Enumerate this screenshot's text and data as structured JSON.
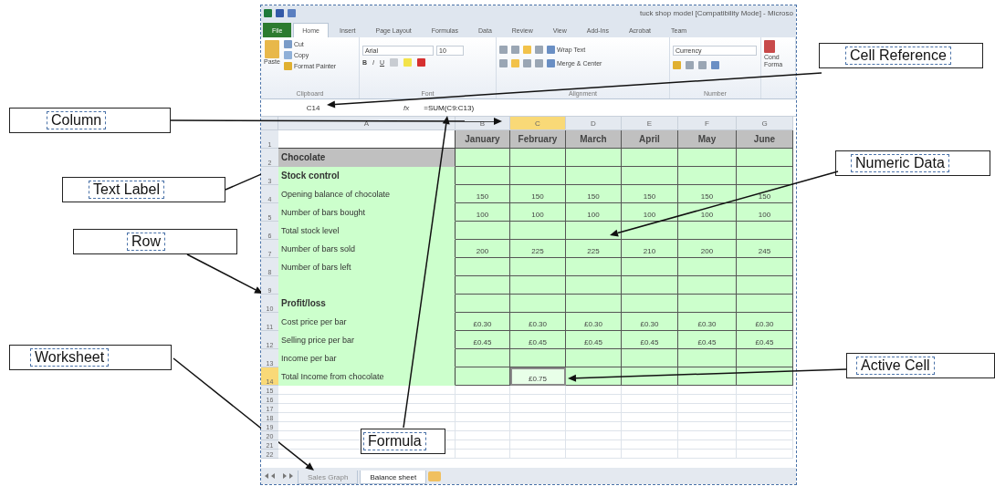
{
  "window": {
    "title": "tuck shop model [Compatibility Mode] - Microso"
  },
  "ribbon_tabs": [
    {
      "label": "File",
      "kind": "file",
      "selected": false
    },
    {
      "label": "Home",
      "kind": "tab",
      "selected": true
    },
    {
      "label": "Insert",
      "kind": "tab",
      "selected": false
    },
    {
      "label": "Page Layout",
      "kind": "tab",
      "selected": false
    },
    {
      "label": "Formulas",
      "kind": "tab",
      "selected": false
    },
    {
      "label": "Data",
      "kind": "tab",
      "selected": false
    },
    {
      "label": "Review",
      "kind": "tab",
      "selected": false
    },
    {
      "label": "View",
      "kind": "tab",
      "selected": false
    },
    {
      "label": "Add-Ins",
      "kind": "tab",
      "selected": false
    },
    {
      "label": "Acrobat",
      "kind": "tab",
      "selected": false
    },
    {
      "label": "Team",
      "kind": "tab",
      "selected": false
    }
  ],
  "ribbon": {
    "clipboard": {
      "label": "Clipboard",
      "paste": "Paste",
      "cut": "Cut",
      "copy": "Copy",
      "format_painter": "Format Painter"
    },
    "font": {
      "label": "Font",
      "font_name": "Arial",
      "font_size": "10",
      "bold": "B",
      "italic": "I",
      "underline": "U"
    },
    "alignment": {
      "label": "Alignment",
      "wrap_text": "Wrap Text",
      "merge": "Merge & Center"
    },
    "number": {
      "label": "Number",
      "format": "Currency"
    },
    "styles": {
      "line_1": "Cond",
      "line_2": "Forma"
    }
  },
  "formula_bar": {
    "name_box": "C14",
    "fx": "fx",
    "formula": "=SUM(C9:C13)"
  },
  "columns": [
    {
      "label": "A",
      "selected": false
    },
    {
      "label": "B",
      "selected": false
    },
    {
      "label": "C",
      "selected": true
    },
    {
      "label": "D",
      "selected": false
    },
    {
      "label": "E",
      "selected": false
    },
    {
      "label": "F",
      "selected": false
    },
    {
      "label": "G",
      "selected": false
    }
  ],
  "rows": [
    {
      "number": "1",
      "kind": "header",
      "selected": false,
      "cells": [
        {
          "text": "January",
          "selected": false
        },
        {
          "text": "February",
          "selected": false
        },
        {
          "text": "March",
          "selected": false
        },
        {
          "text": "April",
          "selected": false
        },
        {
          "text": "May",
          "selected": false
        },
        {
          "text": "June",
          "selected": false
        }
      ]
    },
    {
      "number": "2",
      "kind": "title",
      "label": "Chocolate",
      "selected": false,
      "cells": [
        {
          "selected": false
        },
        {
          "selected": false
        },
        {
          "selected": false
        },
        {
          "selected": false
        },
        {
          "selected": false
        },
        {
          "selected": false
        }
      ]
    },
    {
      "number": "3",
      "kind": "heading",
      "label": "Stock control",
      "selected": false,
      "cells": [
        {
          "selected": false
        },
        {
          "selected": false
        },
        {
          "selected": false
        },
        {
          "selected": false
        },
        {
          "selected": false
        },
        {
          "selected": false
        }
      ]
    },
    {
      "number": "4",
      "kind": "item",
      "label": "Opening balance of chocolate",
      "selected": false,
      "cells": [
        {
          "text": "150",
          "selected": false
        },
        {
          "text": "150",
          "selected": false
        },
        {
          "text": "150",
          "selected": false
        },
        {
          "text": "150",
          "selected": false
        },
        {
          "text": "150",
          "selected": false
        },
        {
          "text": "150",
          "selected": false
        }
      ]
    },
    {
      "number": "5",
      "kind": "item",
      "label": "Number of bars bought",
      "selected": false,
      "cells": [
        {
          "text": "100",
          "selected": false
        },
        {
          "text": "100",
          "selected": false
        },
        {
          "text": "100",
          "selected": false
        },
        {
          "text": "100",
          "selected": false
        },
        {
          "text": "100",
          "selected": false
        },
        {
          "text": "100",
          "selected": false
        }
      ]
    },
    {
      "number": "6",
      "kind": "item",
      "label": "Total stock level",
      "selected": false,
      "cells": [
        {
          "selected": false
        },
        {
          "selected": false
        },
        {
          "selected": false
        },
        {
          "selected": false
        },
        {
          "selected": false
        },
        {
          "selected": false
        }
      ]
    },
    {
      "number": "7",
      "kind": "item",
      "label": "Number of bars sold",
      "selected": false,
      "cells": [
        {
          "text": "200",
          "selected": false
        },
        {
          "text": "225",
          "selected": false
        },
        {
          "text": "225",
          "selected": false
        },
        {
          "text": "210",
          "selected": false
        },
        {
          "text": "200",
          "selected": false
        },
        {
          "text": "245",
          "selected": false
        }
      ]
    },
    {
      "number": "8",
      "kind": "item",
      "label": "Number of bars left",
      "selected": false,
      "cells": [
        {
          "selected": false
        },
        {
          "selected": false
        },
        {
          "selected": false
        },
        {
          "selected": false
        },
        {
          "selected": false
        },
        {
          "selected": false
        }
      ]
    },
    {
      "number": "9",
      "kind": "item",
      "selected": false,
      "cells": [
        {
          "selected": false
        },
        {
          "selected": false
        },
        {
          "selected": false
        },
        {
          "selected": false
        },
        {
          "selected": false
        },
        {
          "selected": false
        }
      ]
    },
    {
      "number": "10",
      "kind": "heading",
      "label": "Profit/loss",
      "selected": false,
      "cells": [
        {
          "selected": false
        },
        {
          "selected": false
        },
        {
          "selected": false
        },
        {
          "selected": false
        },
        {
          "selected": false
        },
        {
          "selected": false
        }
      ]
    },
    {
      "number": "11",
      "kind": "item",
      "label": "Cost price per bar",
      "selected": false,
      "cells": [
        {
          "text": "£0.30",
          "selected": false
        },
        {
          "text": "£0.30",
          "selected": false
        },
        {
          "text": "£0.30",
          "selected": false
        },
        {
          "text": "£0.30",
          "selected": false
        },
        {
          "text": "£0.30",
          "selected": false
        },
        {
          "text": "£0.30",
          "selected": false
        }
      ]
    },
    {
      "number": "12",
      "kind": "item",
      "label": "Selling price per bar",
      "selected": false,
      "cells": [
        {
          "text": "£0.45",
          "selected": false
        },
        {
          "text": "£0.45",
          "selected": false
        },
        {
          "text": "£0.45",
          "selected": false
        },
        {
          "text": "£0.45",
          "selected": false
        },
        {
          "text": "£0.45",
          "selected": false
        },
        {
          "text": "£0.45",
          "selected": false
        }
      ]
    },
    {
      "number": "13",
      "kind": "item",
      "label": "Income per bar",
      "selected": false,
      "cells": [
        {
          "selected": false
        },
        {
          "selected": false
        },
        {
          "selected": false
        },
        {
          "selected": false
        },
        {
          "selected": false
        },
        {
          "selected": false
        }
      ]
    },
    {
      "number": "14",
      "kind": "item",
      "label": "Total Income from chocolate",
      "selected": true,
      "cells": [
        {
          "selected": false
        },
        {
          "text": "£0.75",
          "selected": true
        },
        {
          "selected": false
        },
        {
          "selected": false
        },
        {
          "selected": false
        },
        {
          "selected": false
        }
      ]
    }
  ],
  "empty_rows": [
    {
      "number": "15"
    },
    {
      "number": "16"
    },
    {
      "number": "17"
    },
    {
      "number": "18"
    },
    {
      "number": "19"
    },
    {
      "number": "20"
    },
    {
      "number": "21"
    },
    {
      "number": "22"
    }
  ],
  "sheet_tabs": [
    {
      "label": "Sales Graph",
      "selected": false
    },
    {
      "label": "Balance sheet",
      "selected": true
    }
  ],
  "callouts": [
    {
      "label": "Cell Reference"
    },
    {
      "label": "Column"
    },
    {
      "label": "Numeric Data"
    },
    {
      "label": "Text Label"
    },
    {
      "label": "Row"
    },
    {
      "label": "Worksheet"
    },
    {
      "label": "Active Cell"
    },
    {
      "label": "Formula"
    }
  ]
}
